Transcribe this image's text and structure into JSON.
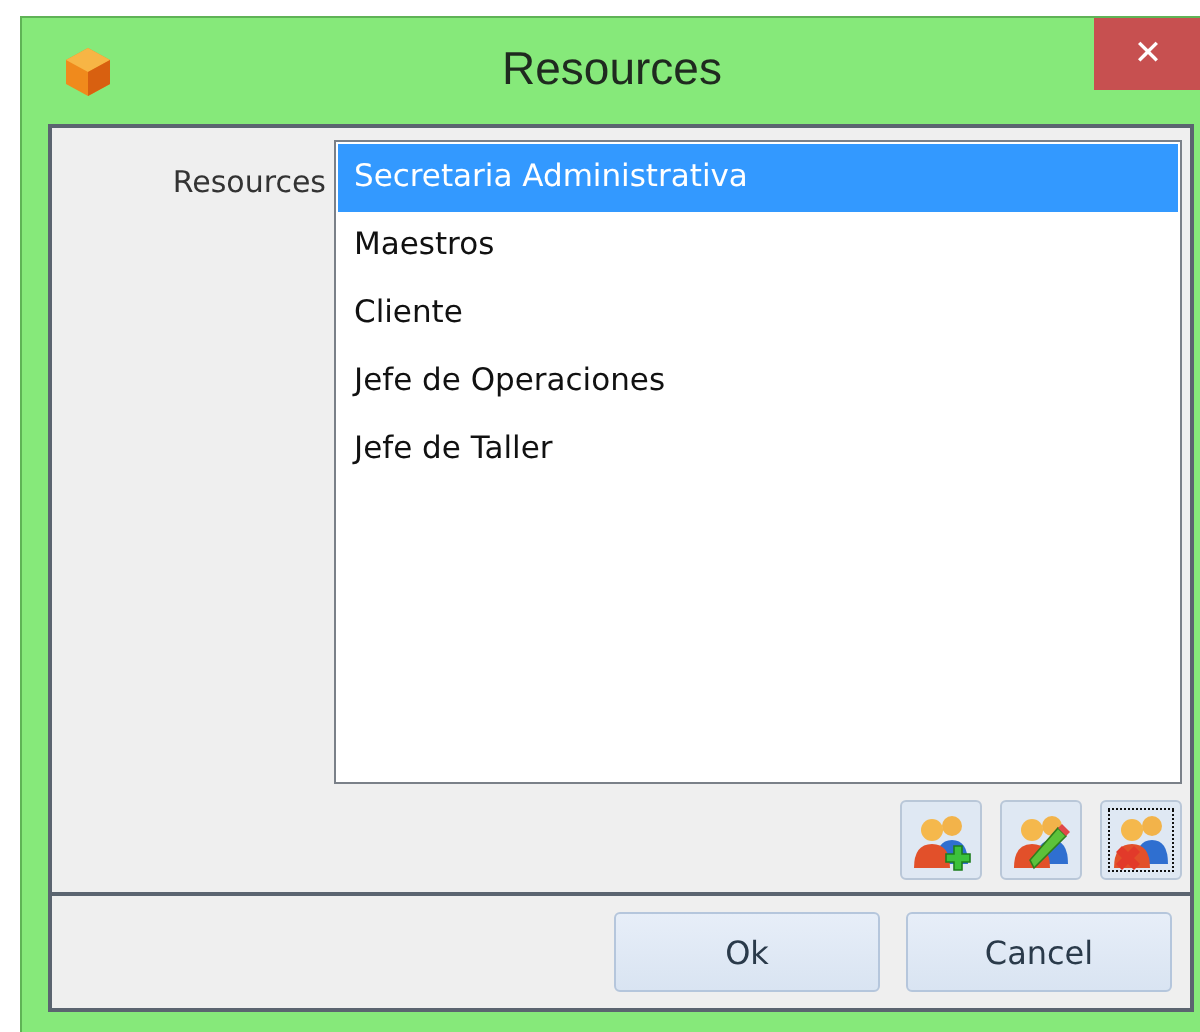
{
  "window": {
    "title": "Resources",
    "close": "✕"
  },
  "field": {
    "label": "Resources"
  },
  "list": {
    "items": [
      {
        "label": "Secretaria Administrativa",
        "selected": true
      },
      {
        "label": "Maestros",
        "selected": false
      },
      {
        "label": "Cliente",
        "selected": false
      },
      {
        "label": "Jefe de Operaciones",
        "selected": false
      },
      {
        "label": "Jefe de Taller",
        "selected": false
      }
    ]
  },
  "tools": [
    {
      "kind": "add",
      "focused": false
    },
    {
      "kind": "edit",
      "focused": false
    },
    {
      "kind": "delete",
      "focused": true
    }
  ],
  "buttons": [
    {
      "label": "Ok"
    },
    {
      "label": "Cancel"
    }
  ]
}
